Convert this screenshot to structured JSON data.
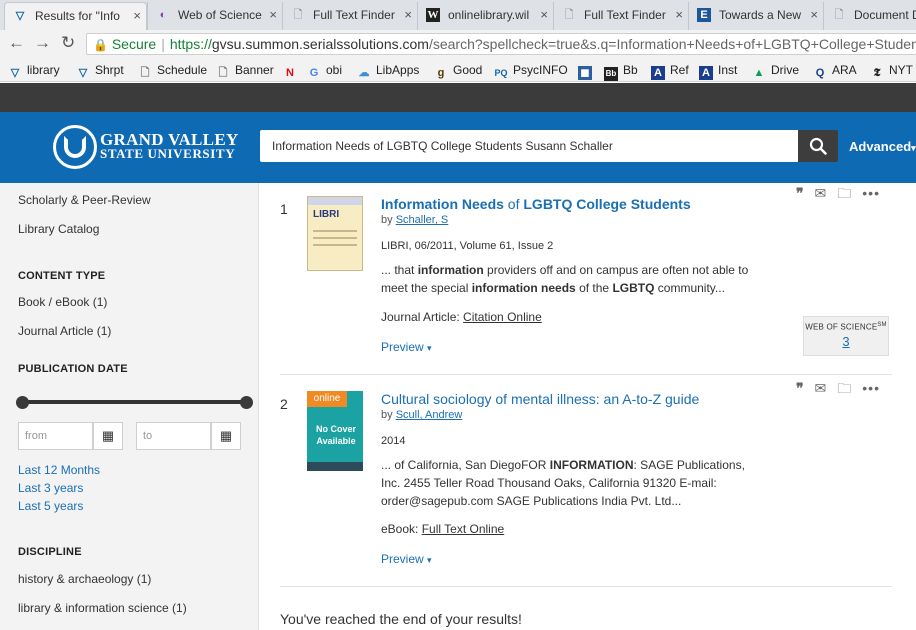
{
  "browser": {
    "tabs": [
      {
        "label": "Results for \"Info",
        "favicon": "gvsu-icon"
      },
      {
        "label": "Web of Science",
        "favicon": "web-of-science-icon"
      },
      {
        "label": "Full Text Finder",
        "favicon": "document-icon"
      },
      {
        "label": "onlinelibrary.wil",
        "favicon": "wiley-icon"
      },
      {
        "label": "Full Text Finder",
        "favicon": "document-icon"
      },
      {
        "label": "Towards a New",
        "favicon": "e-icon"
      },
      {
        "label": "Document De",
        "favicon": "document-icon"
      }
    ],
    "tab_close": "×",
    "secure_label": "Secure",
    "url_prefix": "https://",
    "url_host": "gvsu.summon.serialssolutions.com",
    "url_rest": "/search?spellcheck=true&s.q=Information+Needs+of+LGBTQ+College+Students++Susan",
    "bookmarks": [
      {
        "label": "library",
        "icon": "gvsu-icon"
      },
      {
        "label": "Shrpt",
        "icon": "gvsu-icon"
      },
      {
        "label": "Schedule",
        "icon": "document-icon"
      },
      {
        "label": "Banner",
        "icon": "document-icon"
      },
      {
        "label": "",
        "icon": "netflix-icon"
      },
      {
        "label": "obi",
        "icon": "google-icon"
      },
      {
        "label": "LibApps",
        "icon": "libapps-icon"
      },
      {
        "label": "Good",
        "icon": "goodreads-icon"
      },
      {
        "label": "PsycINFO",
        "icon": "pq-icon"
      },
      {
        "label": "",
        "icon": "jstor-icon"
      },
      {
        "label": "Bb",
        "icon": "blackboard-icon"
      },
      {
        "label": "Ref",
        "icon": "a-icon"
      },
      {
        "label": "Inst",
        "icon": "a-icon"
      },
      {
        "label": "Drive",
        "icon": "drive-icon"
      },
      {
        "label": "ARA",
        "icon": "q-icon"
      },
      {
        "label": "NYT",
        "icon": "nyt-icon"
      }
    ]
  },
  "header": {
    "logo_line1": "GRAND VALLEY",
    "logo_line2": "STATE UNIVERSITY",
    "search_value": "Information Needs of LGBTQ College Students  Susann Schaller",
    "advanced_label": "Advanced"
  },
  "sidebar": {
    "top_links": [
      "Scholarly & Peer-Review",
      "Library Catalog"
    ],
    "content_type_heading": "CONTENT TYPE",
    "content_types": [
      "Book / eBook (1)",
      "Journal Article (1)"
    ],
    "pub_date_heading": "PUBLICATION DATE",
    "from_placeholder": "from",
    "to_placeholder": "to",
    "date_links": [
      "Last 12 Months",
      "Last 3 years",
      "Last 5 years"
    ],
    "discipline_heading": "DISCIPLINE",
    "disciplines": [
      "history & archaeology (1)",
      "library & information science (1)"
    ]
  },
  "results": [
    {
      "number": "1",
      "title_parts": [
        {
          "text": "Information Needs",
          "bold": true
        },
        {
          "text": " of ",
          "bold": false
        },
        {
          "text": "LGBTQ College Students",
          "bold": true
        }
      ],
      "by_prefix": "by ",
      "author": "Schaller, S",
      "meta": "LIBRI, 06/2011, Volume 61, Issue 2",
      "snippet_parts": [
        {
          "text": "... that ",
          "bold": false
        },
        {
          "text": "information",
          "bold": true
        },
        {
          "text": " providers off and on campus are often not able to meet the special ",
          "bold": false
        },
        {
          "text": "information needs",
          "bold": true
        },
        {
          "text": " of the ",
          "bold": false
        },
        {
          "text": "LGBTQ",
          "bold": true
        },
        {
          "text": " community...",
          "bold": false
        }
      ],
      "link_prefix": "Journal Article: ",
      "link_label": "Citation Online",
      "preview_label": "Preview",
      "cover_title": "LIBRI",
      "wos_label": "WEB OF SCIENCE",
      "wos_sm": "SM",
      "wos_count": "3"
    },
    {
      "number": "2",
      "title": "Cultural sociology of mental illness: an A-to-Z guide",
      "by_prefix": "by ",
      "author": "Scull, Andrew",
      "meta": "2014",
      "snippet_parts": [
        {
          "text": "... of California, San DiegoFOR ",
          "bold": false
        },
        {
          "text": "INFORMATION",
          "bold": true
        },
        {
          "text": ": SAGE Publications, Inc. 2455 Teller Road Thousand Oaks, California 91320 E-mail: order@sagepub.com SAGE Publications India Pvt. Ltd...",
          "bold": false
        }
      ],
      "link_prefix": "eBook: ",
      "link_label": "Full Text Online",
      "preview_label": "Preview",
      "cover_badge": "online",
      "cover_text": "No Cover Available"
    }
  ],
  "end_message": "You've reached the end of your results!",
  "colors": {
    "brand_blue": "#0f6ab4",
    "link_blue": "#1a6fb5",
    "online_badge": "#f08a24",
    "no_cover_teal": "#1ba3a3"
  }
}
